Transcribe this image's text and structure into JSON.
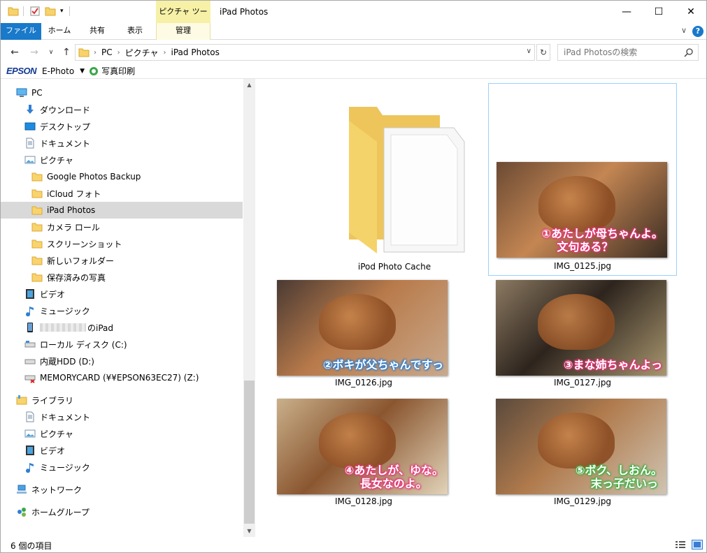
{
  "window": {
    "title": "iPad Photos",
    "context_tab_group": "ピクチャ ツール",
    "controls": {
      "minimize": "—",
      "maximize": "☐",
      "close": "✕"
    }
  },
  "ribbon": {
    "tabs": [
      "ファイル",
      "ホーム",
      "共有",
      "表示"
    ],
    "context_tab": "管理",
    "help": "?"
  },
  "address": {
    "crumbs": [
      "PC",
      "ピクチャ",
      "iPad Photos"
    ],
    "search_placeholder": "iPad Photosの検索"
  },
  "epson_bar": {
    "brand": "EPSON",
    "app": "E-Photo",
    "print": "写真印刷"
  },
  "nav": {
    "items": [
      {
        "label": "PC",
        "icon": "pc-icon",
        "level": 1
      },
      {
        "label": "ダウンロード",
        "icon": "download-icon",
        "level": 2
      },
      {
        "label": "デスクトップ",
        "icon": "desktop-icon",
        "level": 2
      },
      {
        "label": "ドキュメント",
        "icon": "document-icon",
        "level": 2
      },
      {
        "label": "ピクチャ",
        "icon": "pictures-icon",
        "level": 2
      },
      {
        "label": "Google Photos Backup",
        "icon": "folder-icon",
        "level": 3
      },
      {
        "label": "iCloud フォト",
        "icon": "folder-icon",
        "level": 3
      },
      {
        "label": "iPad Photos",
        "icon": "folder-icon",
        "level": 3,
        "selected": true
      },
      {
        "label": "カメラ ロール",
        "icon": "folder-icon",
        "level": 3
      },
      {
        "label": "スクリーンショット",
        "icon": "folder-icon",
        "level": 3
      },
      {
        "label": "新しいフォルダー",
        "icon": "folder-icon",
        "level": 3
      },
      {
        "label": "保存済みの写真",
        "icon": "folder-icon",
        "level": 3
      },
      {
        "label": "ビデオ",
        "icon": "video-icon",
        "level": 2
      },
      {
        "label": "ミュージック",
        "icon": "music-icon",
        "level": 2
      },
      {
        "label": "のiPad",
        "icon": "ipad-icon",
        "level": 2,
        "redacted_prefix": true
      },
      {
        "label": "ローカル ディスク (C:)",
        "icon": "local-disk-icon",
        "level": 2
      },
      {
        "label": "内蔵HDD (D:)",
        "icon": "hdd-icon",
        "level": 2
      },
      {
        "label": "MEMORYCARD (¥¥EPSON63EC27) (Z:)",
        "icon": "network-drive-icon",
        "level": 2
      },
      {
        "label": "ライブラリ",
        "icon": "library-icon",
        "level": 1,
        "gap_before": true
      },
      {
        "label": "ドキュメント",
        "icon": "document-icon",
        "level": 2
      },
      {
        "label": "ピクチャ",
        "icon": "pictures-icon",
        "level": 2
      },
      {
        "label": "ビデオ",
        "icon": "video-icon",
        "level": 2
      },
      {
        "label": "ミュージック",
        "icon": "music-icon",
        "level": 2
      },
      {
        "label": "ネットワーク",
        "icon": "network-icon",
        "level": 1,
        "gap_before": true
      },
      {
        "label": "ホームグループ",
        "icon": "homegroup-icon",
        "level": 1,
        "gap_before": true
      }
    ]
  },
  "files": [
    {
      "name": "iPod Photo Cache",
      "type": "folder"
    },
    {
      "name": "IMG_0125.jpg",
      "type": "image",
      "selected": true,
      "caption": [
        "①あたしが母ちゃんよ。",
        "文句ある？"
      ],
      "caption_color": "#e8347a",
      "bg": [
        "#6b4a33",
        "#c48653",
        "#3a2c22"
      ]
    },
    {
      "name": "IMG_0126.jpg",
      "type": "image",
      "caption": [
        "②ボキが父ちゃんですっ"
      ],
      "caption_color": "#2a7fd4",
      "bg": [
        "#4a3a33",
        "#b87a4a",
        "#c9a98c"
      ]
    },
    {
      "name": "IMG_0127.jpg",
      "type": "image",
      "caption": [
        "③まな姉ちゃんよっ"
      ],
      "caption_color": "#e8347a",
      "bg": [
        "#8c7a62",
        "#2d241d",
        "#a8966f"
      ]
    },
    {
      "name": "IMG_0128.jpg",
      "type": "image",
      "caption": [
        "④あたしが、ゆな。",
        "長女なのよ。"
      ],
      "caption_color": "#e8347a",
      "bg": [
        "#c9b08a",
        "#8a5630",
        "#e2d3b8"
      ]
    },
    {
      "name": "IMG_0129.jpg",
      "type": "image",
      "caption": [
        "⑤ボク、しおん。",
        "末っ子だいっ"
      ],
      "caption_color": "#3bb040",
      "bg": [
        "#5a4a3c",
        "#b07a4c",
        "#cfc4b2"
      ]
    }
  ],
  "status": {
    "item_count": "6 個の項目"
  }
}
